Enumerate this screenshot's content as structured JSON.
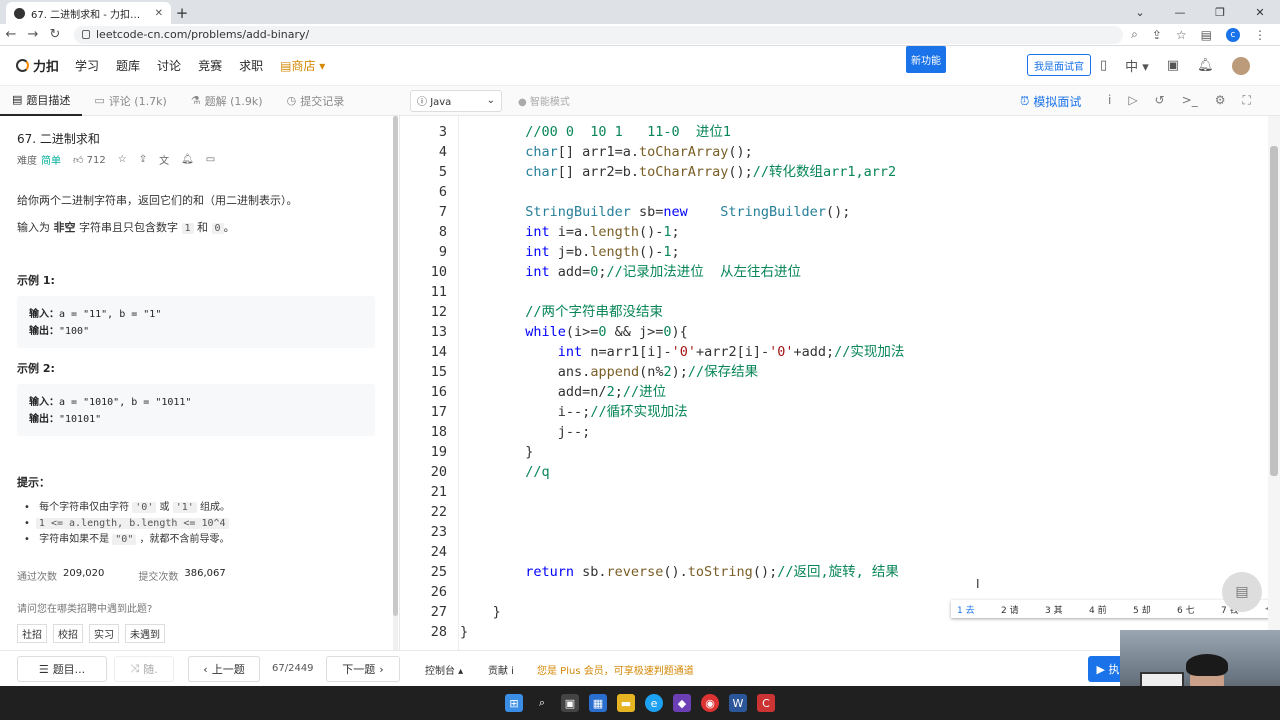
{
  "browser": {
    "tab_title": "67. 二进制求和 - 力扣（LeetCode）",
    "url": "leetcode-cn.com/problems/add-binary/",
    "profile_letter": "c"
  },
  "site": {
    "logo": "力扣",
    "nav": [
      "学习",
      "题库",
      "讨论",
      "竞赛",
      "求职"
    ],
    "shop": "商店",
    "new_feature": "新功能",
    "interviewer": "我是面试官",
    "lang_switch": "中"
  },
  "toolbar": {
    "tabs": [
      {
        "label": "题目描述"
      },
      {
        "label": "评论 (1.7k)"
      },
      {
        "label": "题解 (1.9k)"
      },
      {
        "label": "提交记录"
      }
    ],
    "language": "Java",
    "smart_mode": "智能模式",
    "mock_interview": "模拟面试"
  },
  "problem": {
    "title": "67. 二进制求和",
    "difficulty_label": "难度",
    "difficulty": "简单",
    "likes": "712",
    "desc1": "给你两个二进制字符串，返回它们的和（用二进制表示）。",
    "desc2_pre": "输入为",
    "desc2_bold": "非空",
    "desc2_mid": "字符串且只包含数字",
    "desc2_c1": "1",
    "desc2_and": "和",
    "desc2_c0": "0",
    "desc2_end": "。",
    "examples": [
      {
        "label": "示例 1:",
        "input_label": "输入：",
        "input": "a = \"11\", b = \"1\"",
        "output_label": "输出：",
        "output": "\"100\""
      },
      {
        "label": "示例 2:",
        "input_label": "输入：",
        "input": "a = \"1010\", b = \"1011\"",
        "output_label": "输出：",
        "output": "\"10101\""
      }
    ],
    "hint_label": "提示：",
    "hints": [
      {
        "pre": "每个字符串仅由字符",
        "c1": "'0'",
        "mid": "或",
        "c2": "'1'",
        "post": "组成。"
      },
      {
        "code": "1 <= a.length, b.length <= 10^4"
      },
      {
        "pre": "字符串如果不是",
        "c1": "\"0\"",
        "post": "，就都不含前导零。"
      }
    ],
    "accepted_label": "通过次数",
    "accepted": "209,020",
    "submissions_label": "提交次数",
    "submissions": "386,067",
    "ask": "请问您在哪类招聘中遇到此题?",
    "tags": [
      "社招",
      "校招",
      "实习",
      "未遇到"
    ]
  },
  "editor": {
    "lines": [
      {
        "n": "3",
        "indent": 8,
        "segs": [
          [
            "cm",
            "//00 0  10 1   11-0  进位1"
          ]
        ]
      },
      {
        "n": "4",
        "indent": 8,
        "segs": [
          [
            "ty",
            "char"
          ],
          [
            "",
            "[] arr1=a."
          ],
          [
            "fn",
            "toCharArray"
          ],
          [
            "",
            "();"
          ]
        ]
      },
      {
        "n": "5",
        "indent": 8,
        "segs": [
          [
            "ty",
            "char"
          ],
          [
            "",
            "[] arr2=b."
          ],
          [
            "fn",
            "toCharArray"
          ],
          [
            "",
            "();"
          ],
          [
            "cm",
            "//转化数组arr1,arr2"
          ]
        ]
      },
      {
        "n": "6",
        "indent": 0,
        "segs": []
      },
      {
        "n": "7",
        "indent": 8,
        "segs": [
          [
            "ty",
            "StringBuilder"
          ],
          [
            "",
            " sb="
          ],
          [
            "kw",
            "new"
          ],
          [
            "",
            "    "
          ],
          [
            "ty",
            "StringBuilder"
          ],
          [
            "",
            "();"
          ]
        ]
      },
      {
        "n": "8",
        "indent": 8,
        "segs": [
          [
            "kw",
            "int"
          ],
          [
            "",
            " i=a."
          ],
          [
            "fn",
            "length"
          ],
          [
            "",
            "()-"
          ],
          [
            "nu",
            "1"
          ],
          [
            "",
            ";"
          ]
        ]
      },
      {
        "n": "9",
        "indent": 8,
        "segs": [
          [
            "kw",
            "int"
          ],
          [
            "",
            " j=b."
          ],
          [
            "fn",
            "length"
          ],
          [
            "",
            "()-"
          ],
          [
            "nu",
            "1"
          ],
          [
            "",
            ";"
          ]
        ]
      },
      {
        "n": "10",
        "indent": 8,
        "segs": [
          [
            "kw",
            "int"
          ],
          [
            "",
            " add="
          ],
          [
            "nu",
            "0"
          ],
          [
            "",
            ";"
          ],
          [
            "cm",
            "//记录加法进位  从左往右进位"
          ]
        ]
      },
      {
        "n": "11",
        "indent": 0,
        "segs": []
      },
      {
        "n": "12",
        "indent": 8,
        "segs": [
          [
            "cm",
            "//两个字符串都没结束"
          ]
        ]
      },
      {
        "n": "13",
        "indent": 8,
        "segs": [
          [
            "kw",
            "while"
          ],
          [
            "",
            "(i>="
          ],
          [
            "nu",
            "0"
          ],
          [
            "",
            " && j>="
          ],
          [
            "nu",
            "0"
          ],
          [
            "",
            "){"
          ]
        ]
      },
      {
        "n": "14",
        "indent": 12,
        "segs": [
          [
            "kw",
            "int"
          ],
          [
            "",
            " n=arr1[i]-"
          ],
          [
            "st",
            "'0'"
          ],
          [
            "",
            "+arr2[i]-"
          ],
          [
            "st",
            "'0'"
          ],
          [
            "",
            "+add;"
          ],
          [
            "cm",
            "//实现加法"
          ]
        ]
      },
      {
        "n": "15",
        "indent": 12,
        "segs": [
          [
            "",
            "ans."
          ],
          [
            "fn",
            "append"
          ],
          [
            "",
            "(n%"
          ],
          [
            "nu",
            "2"
          ],
          [
            "",
            ");"
          ],
          [
            "cm",
            "//保存结果"
          ]
        ]
      },
      {
        "n": "16",
        "indent": 12,
        "segs": [
          [
            "",
            "add=n/"
          ],
          [
            "nu",
            "2"
          ],
          [
            "",
            ";"
          ],
          [
            "cm",
            "//进位"
          ]
        ]
      },
      {
        "n": "17",
        "indent": 12,
        "segs": [
          [
            "",
            "i--;"
          ],
          [
            "cm",
            "//循环实现加法"
          ]
        ]
      },
      {
        "n": "18",
        "indent": 12,
        "segs": [
          [
            "",
            "j--;"
          ]
        ]
      },
      {
        "n": "19",
        "indent": 8,
        "segs": [
          [
            "",
            "}"
          ]
        ]
      },
      {
        "n": "20",
        "indent": 8,
        "segs": [
          [
            "cm",
            "//q"
          ]
        ]
      },
      {
        "n": "21",
        "indent": 0,
        "segs": []
      },
      {
        "n": "22",
        "indent": 0,
        "segs": []
      },
      {
        "n": "23",
        "indent": 0,
        "segs": []
      },
      {
        "n": "24",
        "indent": 0,
        "segs": []
      },
      {
        "n": "25",
        "indent": 8,
        "segs": [
          [
            "kw",
            "return"
          ],
          [
            "",
            " sb."
          ],
          [
            "fn",
            "reverse"
          ],
          [
            "",
            "()."
          ],
          [
            "fn",
            "toString"
          ],
          [
            "",
            "();"
          ],
          [
            "cm",
            "//返回,旋转, 结果"
          ]
        ]
      },
      {
        "n": "26",
        "indent": 0,
        "segs": []
      },
      {
        "n": "27",
        "indent": 4,
        "segs": [
          [
            "",
            "}"
          ]
        ]
      },
      {
        "n": "28",
        "indent": 0,
        "segs": [
          [
            "",
            "}"
          ]
        ]
      }
    ],
    "ime_candidates": [
      "1 去",
      "2 请",
      "3 其",
      "4 前",
      "5 却",
      "6 七",
      "7 钱"
    ]
  },
  "bottom": {
    "list_label": "题目...",
    "random_label": "随.",
    "prev_label": "上一题",
    "page": "67/2449",
    "next_label": "下一题",
    "console": "控制台",
    "contribute": "贡献 i",
    "plus_text": "您是 Plus 会员，可享极速判题通道",
    "run_label": "执"
  }
}
